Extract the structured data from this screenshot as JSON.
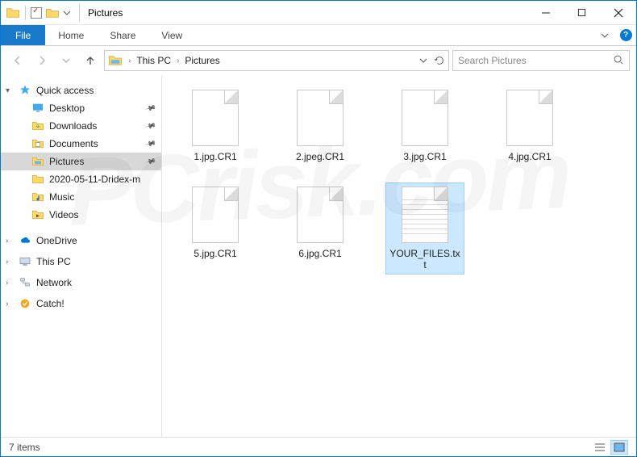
{
  "window": {
    "title": "Pictures"
  },
  "ribbon": {
    "file": "File",
    "tabs": [
      "Home",
      "Share",
      "View"
    ]
  },
  "address": {
    "crumbs": [
      "This PC",
      "Pictures"
    ],
    "search_placeholder": "Search Pictures"
  },
  "nav": {
    "quick_access": {
      "label": "Quick access",
      "items": [
        {
          "label": "Desktop",
          "pinned": true,
          "icon": "desktop"
        },
        {
          "label": "Downloads",
          "pinned": true,
          "icon": "downloads"
        },
        {
          "label": "Documents",
          "pinned": true,
          "icon": "documents"
        },
        {
          "label": "Pictures",
          "pinned": true,
          "icon": "pictures",
          "selected": true
        },
        {
          "label": "2020-05-11-Dridex-m",
          "pinned": false,
          "icon": "folder"
        },
        {
          "label": "Music",
          "pinned": false,
          "icon": "music"
        },
        {
          "label": "Videos",
          "pinned": false,
          "icon": "videos"
        }
      ]
    },
    "roots": [
      {
        "label": "OneDrive",
        "icon": "onedrive"
      },
      {
        "label": "This PC",
        "icon": "thispc"
      },
      {
        "label": "Network",
        "icon": "network"
      },
      {
        "label": "Catch!",
        "icon": "catch"
      }
    ]
  },
  "files": [
    {
      "name": "1.jpg.CR1",
      "type": "blank"
    },
    {
      "name": "2.jpeg.CR1",
      "type": "blank"
    },
    {
      "name": "3.jpg.CR1",
      "type": "blank"
    },
    {
      "name": "4.jpg.CR1",
      "type": "blank"
    },
    {
      "name": "5.jpg.CR1",
      "type": "blank"
    },
    {
      "name": "6.jpg.CR1",
      "type": "blank"
    },
    {
      "name": "YOUR_FILES.txt",
      "type": "text",
      "selected": true
    }
  ],
  "status": {
    "count_label": "7 items"
  },
  "watermark": "PCrisk.com"
}
